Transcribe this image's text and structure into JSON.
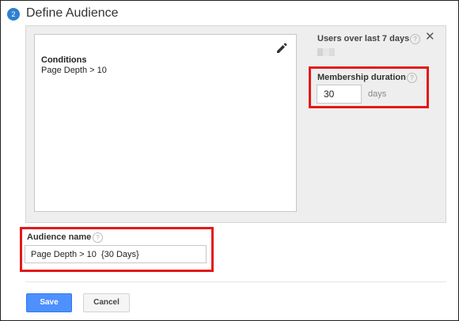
{
  "step": {
    "number": "2",
    "title": "Define Audience"
  },
  "conditions": {
    "title": "Conditions",
    "text": "Page Depth > 10",
    "edit_icon": "pencil-icon"
  },
  "estimate": {
    "label": "Users over last 7 days",
    "help": "?",
    "close": "✕"
  },
  "membership": {
    "label": "Membership duration",
    "help": "?",
    "value": "30",
    "unit": "days"
  },
  "audience_name": {
    "label": "Audience name",
    "help": "?",
    "value": "Page Depth > 10  {30 Days}"
  },
  "buttons": {
    "save": "Save",
    "cancel": "Cancel"
  },
  "colors": {
    "accent": "#4d90fe",
    "step_badge": "#2f80d1",
    "highlight": "#e3191a"
  }
}
